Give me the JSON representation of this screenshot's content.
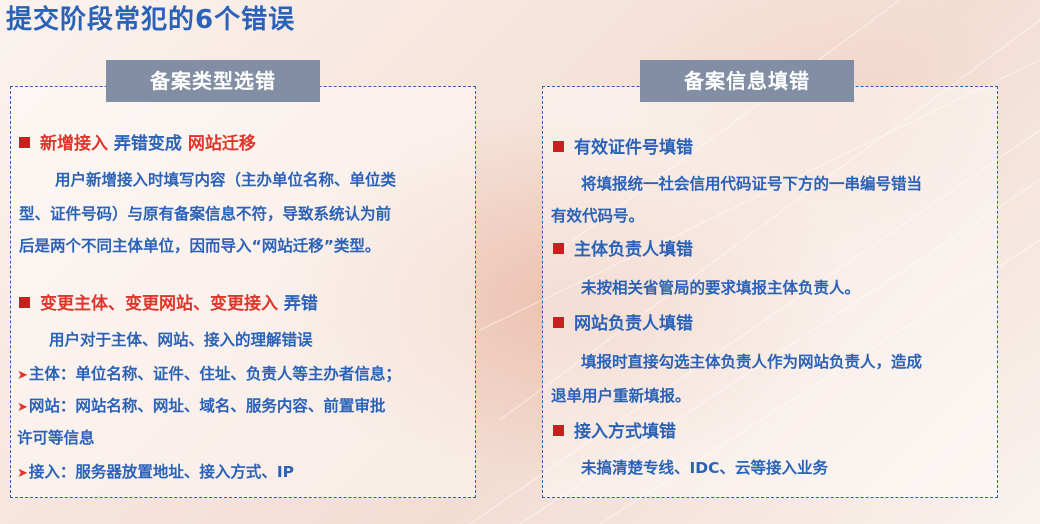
{
  "page": {
    "title": "提交阶段常犯的6个错误"
  },
  "left_panel": {
    "header": "备案类型选错",
    "error1": {
      "title_a": "新增接入",
      "title_b": "弄错变成",
      "title_c": "网站迁移",
      "desc": [
        "用户新增接入时填写内容（主办单位名称、单位类",
        "型、证件号码）与原有备案信息不符，导致系统认为前",
        "后是两个不同主体单位，因而导入“网站迁移”类型。"
      ]
    },
    "error2": {
      "title_a": "变更主体、变更网站、变更接入",
      "title_b": "弄错",
      "intro": "用户对于主体、网站、接入的理解错误",
      "bullets": [
        "主体：单位名称、证件、住址、负责人等主办者信息；",
        "网站：网站名称、网址、域名、服务内容、前置审批",
        "接入：服务器放置地址、接入方式、IP"
      ],
      "bullet2_cont": "许可等信息"
    }
  },
  "right_panel": {
    "header": "备案信息填错",
    "items": [
      {
        "title": "有效证件号填错",
        "desc": [
          "将填报统一社会信用代码证号下方的一串编号错当",
          "有效代码号。"
        ]
      },
      {
        "title": "主体负责人填错",
        "desc": [
          "未按相关省管局的要求填报主体负责人。"
        ]
      },
      {
        "title": "网站负责人填错",
        "desc": [
          "填报时直接勾选主体负责人作为网站负责人，造成",
          "退单用户重新填报。"
        ]
      },
      {
        "title": "接入方式填错",
        "desc": [
          "未搞清楚专线、IDC、云等接入业务"
        ]
      }
    ]
  },
  "colors": {
    "title_blue": "#2a62b8",
    "accent_red": "#e0352a",
    "bullet_red": "#c9201f",
    "header_grey": "#818ea3"
  }
}
